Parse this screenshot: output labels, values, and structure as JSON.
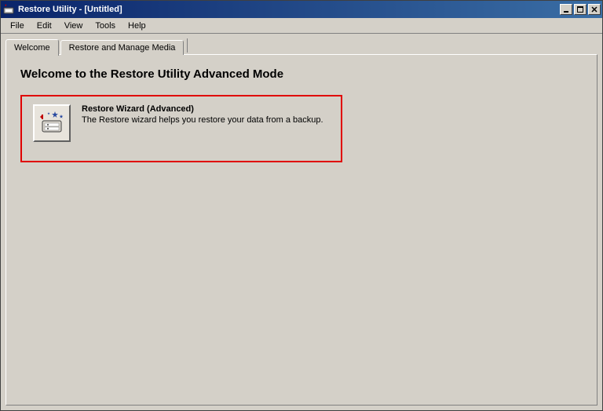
{
  "titlebar": {
    "title": "Restore Utility - [Untitled]"
  },
  "window_controls": {
    "minimize": "_",
    "maximize": "□",
    "close": "×"
  },
  "menubar": {
    "items": [
      "File",
      "Edit",
      "View",
      "Tools",
      "Help"
    ]
  },
  "tabs": {
    "items": [
      {
        "label": "Welcome"
      },
      {
        "label": "Restore and Manage Media"
      }
    ]
  },
  "main": {
    "heading": "Welcome to the Restore Utility Advanced Mode",
    "wizard": {
      "title": "Restore Wizard (Advanced)",
      "description": "The Restore wizard helps you restore your data from a backup."
    }
  }
}
